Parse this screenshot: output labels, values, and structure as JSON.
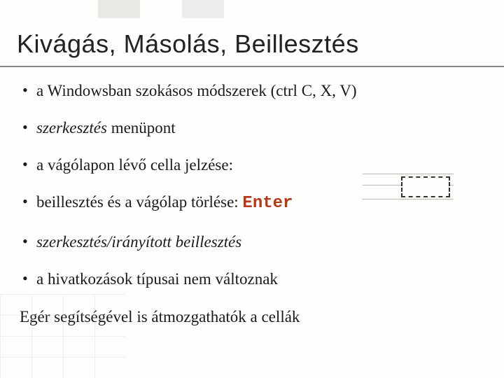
{
  "title": "Kivágás, Másolás, Beillesztés",
  "bullets": {
    "b1": "a Windowsban szokásos módszerek (ctrl C, X, V)",
    "b2_italic": "szerkesztés",
    "b2_rest": " menüpont",
    "b3": "a vágólapon lévő cella jelzése:",
    "b4_pre": "beillesztés és a vágólap törlése: ",
    "b4_key": "Enter",
    "b5_italic": "szerkesztés/irányított beillesztés",
    "b6": "a hivatkozások típusai nem változnak"
  },
  "bottom": "Egér segítségével is átmozgathatók a cellák"
}
